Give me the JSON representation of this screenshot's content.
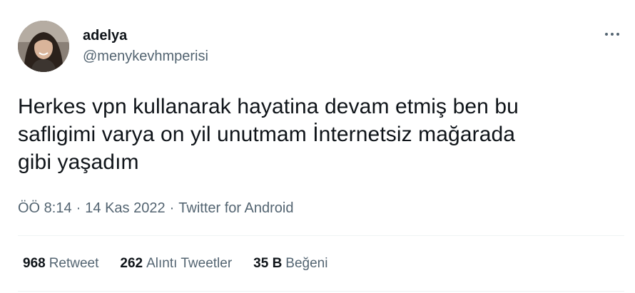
{
  "author": {
    "name": "adelya",
    "handle": "@menykevhmperisi"
  },
  "tweet": {
    "lines": [
      "Herkes vpn kullanarak hayatina devam etmiş ben bu",
      "safligimi varya on yil unutmam İnternetsiz mağarada",
      "gibi yaşadım"
    ]
  },
  "meta": {
    "time": "ÖÖ 8:14",
    "separator": "·",
    "date": "14 Kas 2022",
    "source": "Twitter for Android"
  },
  "stats": {
    "retweets": {
      "count": "968",
      "label": "Retweet"
    },
    "quotes": {
      "count": "262",
      "label": "Alıntı Tweetler"
    },
    "likes": {
      "count": "35 B",
      "label": "Beğeni"
    }
  },
  "icons": {
    "more": "more-horizontal-icon"
  }
}
